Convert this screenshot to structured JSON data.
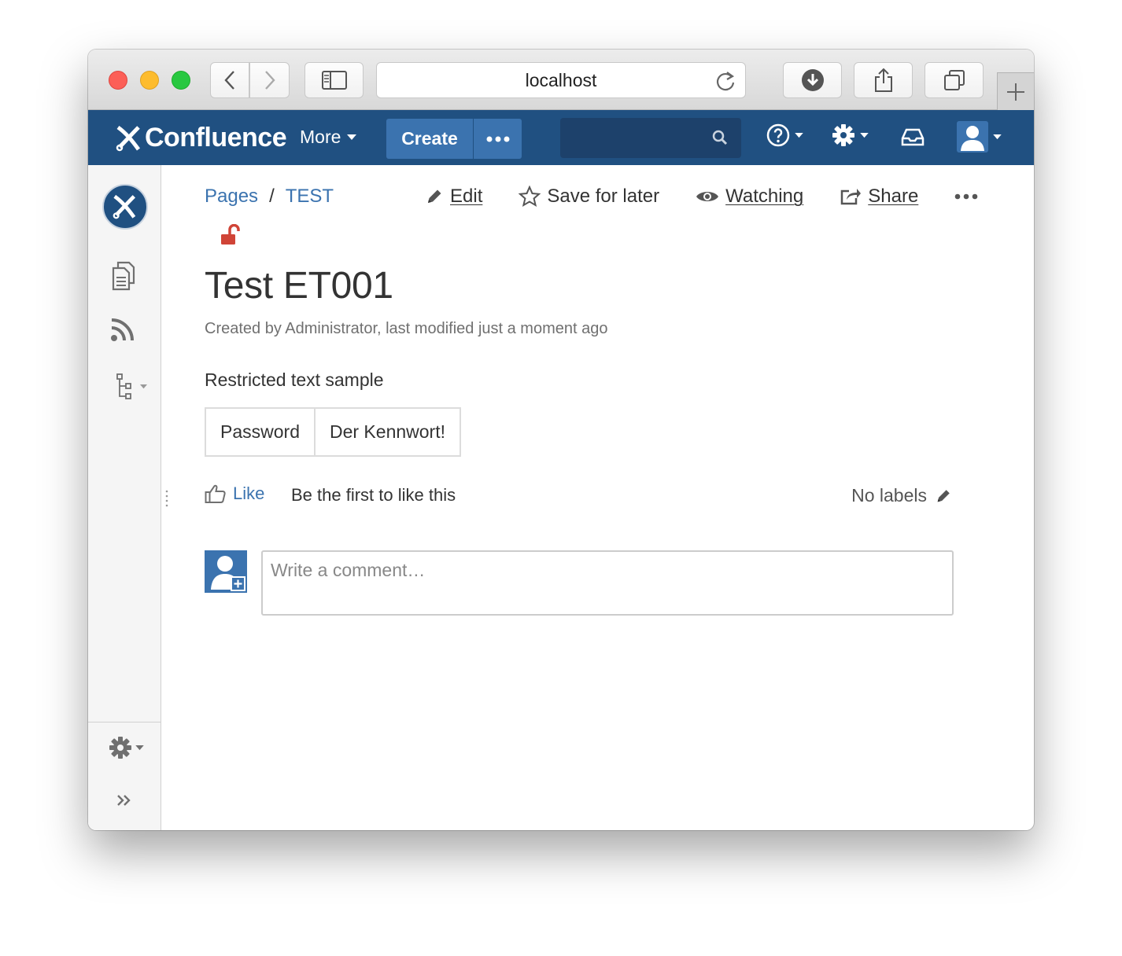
{
  "browser": {
    "url": "localhost"
  },
  "header": {
    "logo_text": "Confluence",
    "more_label": "More",
    "create_label": "Create",
    "search_placeholder": "",
    "colors": {
      "nav_bg": "#205081",
      "button_bg": "#3b73af",
      "search_bg": "#1d416b"
    }
  },
  "page": {
    "breadcrumb": [
      {
        "label": "Pages"
      },
      {
        "label": "TEST"
      }
    ],
    "breadcrumb_sep": "/",
    "actions": {
      "edit": "Edit",
      "save_for_later": "Save for later",
      "watching": "Watching",
      "share": "Share"
    },
    "title": "Test ET001",
    "meta": "Created by Administrator, last modified just a moment ago",
    "body_text": "Restricted text sample",
    "table": [
      [
        "Password",
        "Der Kennwort!"
      ]
    ],
    "like_label": "Like",
    "like_note": "Be the first to like this",
    "labels_text": "No labels",
    "comment_placeholder": "Write a comment…"
  }
}
